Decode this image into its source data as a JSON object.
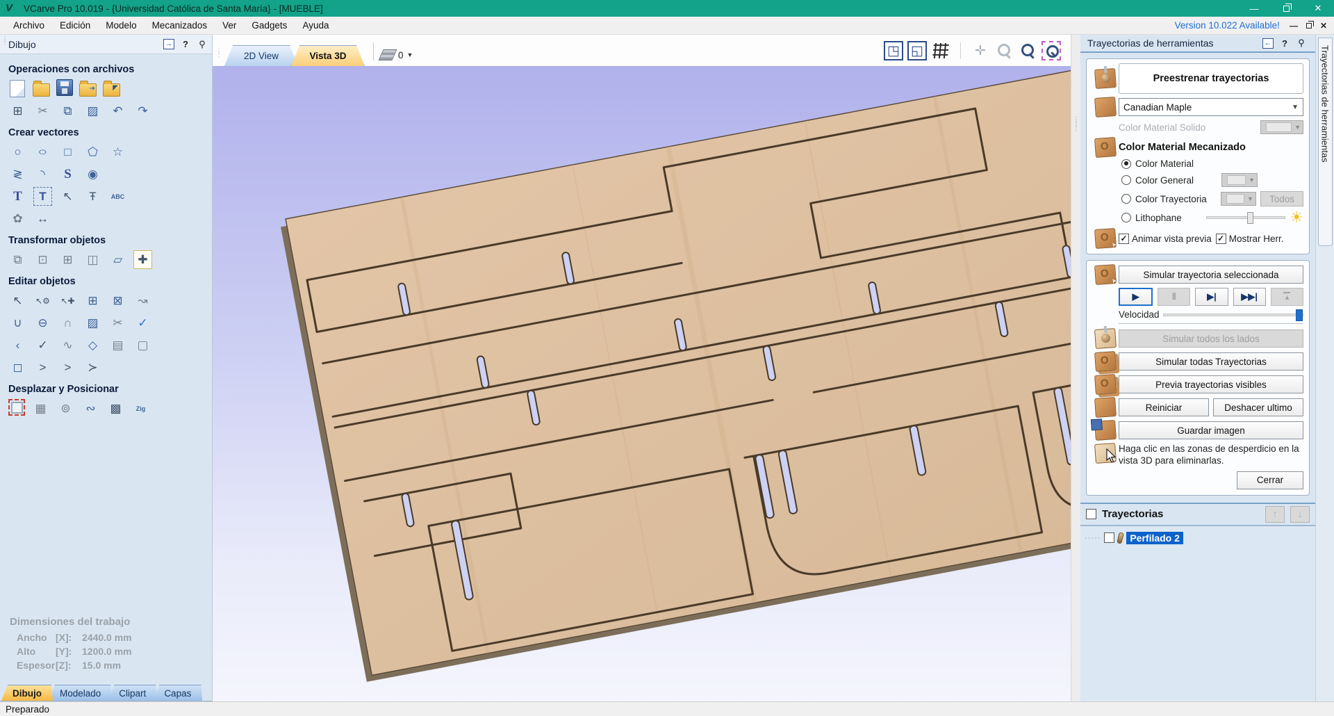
{
  "title_bar": {
    "logo": "V",
    "title": "VCarve Pro 10.019 - {Universidad Católica de Santa María} - [MUEBLE]",
    "minimize_glyph": "—",
    "close_glyph": "✕"
  },
  "menu_bar": {
    "items": [
      "Archivo",
      "Edición",
      "Modelo",
      "Mecanizados",
      "Ver",
      "Gadgets",
      "Ayuda"
    ],
    "version_link": "Version 10.022 Available!",
    "minimize_glyph": "—",
    "close_glyph": "✕"
  },
  "left_panel": {
    "header": {
      "title": "Dibujo",
      "icons": [
        "collapse-panel-icon",
        "help-icon",
        "pin-icon"
      ],
      "help_glyph": "?",
      "pin_glyph": "⚲",
      "collapse_glyph": "→"
    },
    "sections": [
      {
        "title": "Operaciones con archivos",
        "rows": [
          [
            {
              "n": "new-file-icon",
              "t": "page"
            },
            {
              "n": "open-file-icon",
              "t": "folder"
            },
            {
              "n": "save-file-icon",
              "t": "floppy"
            },
            {
              "n": "import-vectors-icon",
              "t": "folder2"
            },
            {
              "n": "export-vectors-icon",
              "t": "folder3"
            }
          ],
          [
            {
              "n": "job-setup-icon",
              "g": "⊞",
              "cls": "dark"
            },
            {
              "n": "cut-icon",
              "g": "✂",
              "cls": "gray"
            },
            {
              "n": "copy-icon",
              "g": "⧉"
            },
            {
              "n": "paste-icon",
              "g": "▨"
            },
            {
              "n": "undo-icon",
              "g": "↶"
            },
            {
              "n": "redo-icon",
              "g": "↷"
            }
          ]
        ]
      },
      {
        "title": "Crear vectores",
        "rows": [
          [
            {
              "n": "draw-circle-icon",
              "g": "○"
            },
            {
              "n": "draw-ellipse-icon",
              "g": "○",
              "cls": "ellipse"
            },
            {
              "n": "draw-rectangle-icon",
              "g": "□"
            },
            {
              "n": "draw-polygon-icon",
              "g": "⬠"
            },
            {
              "n": "draw-star-icon",
              "g": "☆"
            }
          ],
          [
            {
              "n": "draw-polyline-icon",
              "g": "≷"
            },
            {
              "n": "draw-arc-icon",
              "g": "◝"
            },
            {
              "n": "draw-curve-icon",
              "g": "S",
              "cls": "serifT"
            },
            {
              "n": "draw-texture-icon",
              "g": "◉"
            }
          ],
          [
            {
              "n": "draw-text-icon",
              "g": "T",
              "cls": "serifT"
            },
            {
              "n": "draw-text-box-icon",
              "g": "T",
              "cls": "boxed"
            },
            {
              "n": "select-text-icon",
              "g": "↖",
              "cls": "dark"
            },
            {
              "n": "auto-layout-text-icon",
              "g": "Ŧ",
              "cls": "dark"
            },
            {
              "n": "text-on-curve-icon",
              "g": "ABC",
              "cls": "tiny"
            }
          ],
          [
            {
              "n": "clipart-icon",
              "g": "✿",
              "cls": "gray"
            },
            {
              "n": "dimensions-icon",
              "g": "↔",
              "cls": "dark"
            }
          ]
        ]
      },
      {
        "title": "Transformar objetos",
        "rows": [
          [
            {
              "n": "move-objects-icon",
              "g": "⧉",
              "cls": "gray"
            },
            {
              "n": "set-size-icon",
              "g": "⊡",
              "cls": "gray"
            },
            {
              "n": "center-in-material-icon",
              "g": "⊞",
              "cls": "gray"
            },
            {
              "n": "mirror-objects-icon",
              "g": "◫",
              "cls": "gray"
            },
            {
              "n": "distort-object-icon",
              "g": "▱"
            },
            {
              "n": "alignment-icon",
              "g": "✚",
              "cls": "dark active"
            }
          ]
        ]
      },
      {
        "title": "Editar objetos",
        "rows": [
          [
            {
              "n": "select-tool-icon",
              "g": "↖",
              "cls": "dark"
            },
            {
              "n": "node-edit-tool-icon",
              "g": "↖⚙",
              "cls": "dark small"
            },
            {
              "n": "interactive-move-icon",
              "g": "↖✚",
              "cls": "dark small"
            },
            {
              "n": "group-objects-icon",
              "g": "⊞"
            },
            {
              "n": "ungroup-objects-icon",
              "g": "⊠"
            },
            {
              "n": "measure-tool-icon",
              "g": "↝",
              "cls": "gray"
            }
          ],
          [
            {
              "n": "weld-vectors-icon",
              "g": "∪"
            },
            {
              "n": "subtract-vectors-icon",
              "g": "⊖"
            },
            {
              "n": "keep-overlap-icon",
              "g": "∩",
              "cls": "gray"
            },
            {
              "n": "fill-vectors-icon",
              "g": "▨"
            },
            {
              "n": "trim-vectors-icon",
              "g": "✂",
              "cls": "gray"
            },
            {
              "n": "vector-validator-icon",
              "g": "✓",
              "cls": "blue"
            }
          ],
          [
            {
              "n": "fillet-tool-icon",
              "g": "‹"
            },
            {
              "n": "node-vectors-icon",
              "g": "✓",
              "cls": "dark"
            },
            {
              "n": "fit-curves-icon",
              "g": "∿",
              "cls": "gray"
            },
            {
              "n": "close-vector-icon",
              "g": "◇"
            },
            {
              "n": "edit-picture-icon",
              "g": "▤",
              "cls": "gray"
            },
            {
              "n": "crop-picture-icon",
              "g": "▢",
              "cls": "gray"
            }
          ],
          [
            {
              "n": "join-close-vectors-icon",
              "g": "◻"
            },
            {
              "n": "join-with-line-icon",
              "g": ">",
              "cls": "dark"
            },
            {
              "n": "join-with-curve-icon",
              "g": ">",
              "cls": "dark"
            },
            {
              "n": "join-with-move-icon",
              "g": "≻",
              "cls": "dark"
            }
          ]
        ]
      },
      {
        "title": "Desplazar y Posicionar",
        "rows": [
          [
            {
              "n": "align-selection-icon",
              "t": "dashedred"
            },
            {
              "n": "array-copy-icon",
              "g": "▦",
              "cls": "gray"
            },
            {
              "n": "circular-copy-icon",
              "g": "⊚",
              "cls": "gray"
            },
            {
              "n": "copy-along-vectors-icon",
              "g": "∾"
            },
            {
              "n": "nesting-icon",
              "g": "▩",
              "cls": "dark"
            },
            {
              "n": "zigzag-text-icon",
              "g": "Zig",
              "cls": "tiny"
            }
          ]
        ]
      }
    ],
    "dimensions": {
      "title": "Dimensiones del trabajo",
      "rows": [
        {
          "label": "Ancho",
          "axis": "[X]:",
          "value": "2440.0 mm"
        },
        {
          "label": "Alto",
          "axis": "[Y]:",
          "value": "1200.0 mm"
        },
        {
          "label": "Espesor",
          "axis": "[Z]:",
          "value": "15.0 mm"
        }
      ]
    },
    "tabs": [
      {
        "label": "Dibujo",
        "active": true
      },
      {
        "label": "Modelado",
        "active": false
      },
      {
        "label": "Clipart",
        "active": false
      },
      {
        "label": "Capas",
        "active": false
      }
    ]
  },
  "view_area": {
    "tabs": [
      {
        "label": "2D View",
        "active": false
      },
      {
        "label": "Vista 3D",
        "active": true
      }
    ],
    "layers": {
      "value": "0",
      "caret": "▼"
    },
    "toolbar_icons": [
      "zoom-extents-icon",
      "zoom-to-selection-icon",
      "toggle-grid-icon",
      "pan-view-icon",
      "zoom-dynamic-icon",
      "zoom-in-icon",
      "zoom-box-icon"
    ]
  },
  "right_panel": {
    "header": {
      "title": "Trayectorias de herramientas",
      "icons": [
        "collapse-panel-icon",
        "help-icon",
        "pin-icon"
      ],
      "help_glyph": "?",
      "pin_glyph": "⚲",
      "collapse_glyph": "←"
    },
    "preview_box": {
      "title": "Preestrenar trayectorias",
      "material_select": "Canadian Maple",
      "select_caret": "▼",
      "solid_color_label": "Color Material Solido",
      "machined_heading": "Color Material Mecanizado",
      "radios": [
        {
          "label": "Color Material",
          "checked": true
        },
        {
          "label": "Color General",
          "checked": false
        },
        {
          "label": "Color Trayectoria",
          "checked": false
        },
        {
          "label": "Lithophane",
          "checked": false
        }
      ],
      "todos_button": "Todos",
      "sun_glyph": "☀",
      "checkboxes": [
        {
          "label": "Animar vista previa",
          "checked": true
        },
        {
          "label": "Mostrar Herr.",
          "checked": true
        }
      ],
      "check_glyph": "✓"
    },
    "sim_box": {
      "simulate_selected": "Simular trayectoria seleccionada",
      "playback": [
        "▶",
        "Ⅱ",
        "▶|",
        "▶▶|",
        "▲"
      ],
      "velocity_label": "Velocidad",
      "simulate_all_sides": "Simular todos los lados",
      "simulate_all": "Simular todas Trayectorias",
      "preview_visible": "Previa trayectorias visibles",
      "reset": "Reiniciar",
      "undo_last": "Deshacer ultimo",
      "save_image": "Guardar imagen",
      "hint": "Haga clic en las zonas de desperdicio en la vista 3D para eliminarlas.",
      "close": "Cerrar"
    },
    "toolpaths": {
      "title": "Trayectorias",
      "up_glyph": "↑",
      "down_glyph": "↓",
      "items": [
        {
          "label": "Perfilado 2",
          "selected": true,
          "checked": false
        }
      ]
    },
    "side_tab": "Trayectorias de herramientas"
  },
  "status_bar": {
    "text": "Preparado"
  }
}
